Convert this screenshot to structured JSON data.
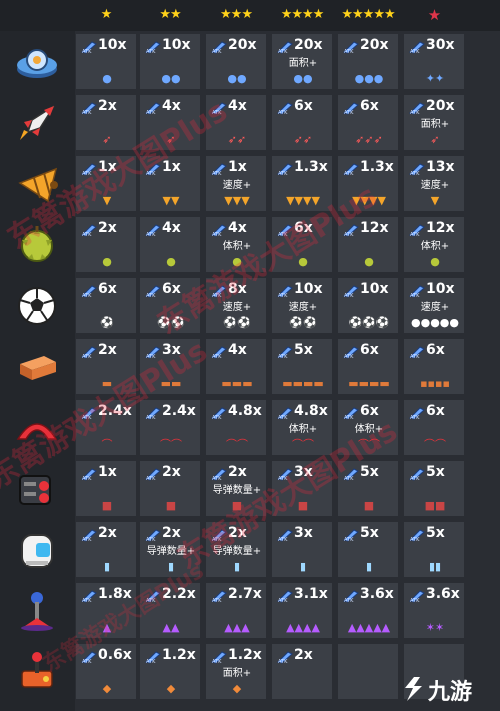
{
  "header": {
    "tiers": [
      "★",
      "★★",
      "★★★",
      "★★★★",
      "★★★★★",
      "★"
    ]
  },
  "colors": {
    "background": "#2a2d33",
    "cell": "#3b3f46",
    "star": "#ffd21a",
    "red_star": "#e0354a",
    "watermark": "#eb283c"
  },
  "rows": [
    {
      "name": "drone",
      "icon": "drone-icon",
      "cells": [
        {
          "mult": "10x",
          "bonus": "",
          "mini": "●"
        },
        {
          "mult": "10x",
          "bonus": "",
          "mini": "●●"
        },
        {
          "mult": "20x",
          "bonus": "",
          "mini": "●●"
        },
        {
          "mult": "20x",
          "bonus": "面积+",
          "mini": "●●"
        },
        {
          "mult": "20x",
          "bonus": "",
          "mini": "●●●"
        },
        {
          "mult": "30x",
          "bonus": "",
          "mini": "✦✦"
        }
      ]
    },
    {
      "name": "rocket",
      "icon": "rocket-icon",
      "cells": [
        {
          "mult": "2x",
          "bonus": "",
          "mini": "➶"
        },
        {
          "mult": "4x",
          "bonus": "",
          "mini": "➶"
        },
        {
          "mult": "4x",
          "bonus": "",
          "mini": "➶➶"
        },
        {
          "mult": "6x",
          "bonus": "",
          "mini": "➶➶"
        },
        {
          "mult": "6x",
          "bonus": "",
          "mini": "➶➶➶"
        },
        {
          "mult": "20x",
          "bonus": "面积+",
          "mini": "➶"
        }
      ]
    },
    {
      "name": "drill",
      "icon": "drill-icon",
      "cells": [
        {
          "mult": "1x",
          "bonus": "",
          "mini": "▼"
        },
        {
          "mult": "1x",
          "bonus": "",
          "mini": "▼▼"
        },
        {
          "mult": "1x",
          "bonus": "速度+",
          "mini": "▼▼▼"
        },
        {
          "mult": "1.3x",
          "bonus": "",
          "mini": "▼▼▼▼"
        },
        {
          "mult": "1.3x",
          "bonus": "",
          "mini": "▼▼▼▼"
        },
        {
          "mult": "13x",
          "bonus": "速度+",
          "mini": "▼"
        }
      ]
    },
    {
      "name": "durian",
      "icon": "durian-icon",
      "cells": [
        {
          "mult": "2x",
          "bonus": "",
          "mini": "●"
        },
        {
          "mult": "4x",
          "bonus": "",
          "mini": "●"
        },
        {
          "mult": "4x",
          "bonus": "体积+",
          "mini": "●"
        },
        {
          "mult": "6x",
          "bonus": "",
          "mini": "●"
        },
        {
          "mult": "12x",
          "bonus": "",
          "mini": "●"
        },
        {
          "mult": "12x",
          "bonus": "体积+",
          "mini": "●"
        }
      ]
    },
    {
      "name": "soccer-ball",
      "icon": "soccer-ball-icon",
      "cells": [
        {
          "mult": "6x",
          "bonus": "",
          "mini": "⚽"
        },
        {
          "mult": "6x",
          "bonus": "",
          "mini": "⚽⚽"
        },
        {
          "mult": "8x",
          "bonus": "速度+",
          "mini": "⚽⚽"
        },
        {
          "mult": "10x",
          "bonus": "速度+",
          "mini": "⚽⚽"
        },
        {
          "mult": "10x",
          "bonus": "",
          "mini": "⚽⚽⚽"
        },
        {
          "mult": "10x",
          "bonus": "速度+",
          "mini": "●●●●●"
        }
      ]
    },
    {
      "name": "brick",
      "icon": "brick-icon",
      "cells": [
        {
          "mult": "2x",
          "bonus": "",
          "mini": "▬"
        },
        {
          "mult": "3x",
          "bonus": "",
          "mini": "▬▬"
        },
        {
          "mult": "4x",
          "bonus": "",
          "mini": "▬▬▬"
        },
        {
          "mult": "5x",
          "bonus": "",
          "mini": "▬▬▬▬"
        },
        {
          "mult": "6x",
          "bonus": "",
          "mini": "▬▬▬▬"
        },
        {
          "mult": "6x",
          "bonus": "",
          "mini": "▪▪▪▪"
        }
      ]
    },
    {
      "name": "boomerang",
      "icon": "boomerang-icon",
      "cells": [
        {
          "mult": "2.4x",
          "bonus": "",
          "mini": "⌒"
        },
        {
          "mult": "2.4x",
          "bonus": "",
          "mini": "⌒⌒"
        },
        {
          "mult": "4.8x",
          "bonus": "",
          "mini": "⌒⌒"
        },
        {
          "mult": "4.8x",
          "bonus": "体积+",
          "mini": "⌒⌒"
        },
        {
          "mult": "6x",
          "bonus": "体积+",
          "mini": "⌒⌒"
        },
        {
          "mult": "6x",
          "bonus": "",
          "mini": "⌒⌒"
        }
      ]
    },
    {
      "name": "missile-launcher",
      "icon": "missile-launcher-icon",
      "cells": [
        {
          "mult": "1x",
          "bonus": "",
          "mini": "■"
        },
        {
          "mult": "2x",
          "bonus": "",
          "mini": "■"
        },
        {
          "mult": "2x",
          "bonus": "导弹数量+",
          "mini": "■"
        },
        {
          "mult": "3x",
          "bonus": "",
          "mini": "■"
        },
        {
          "mult": "5x",
          "bonus": "",
          "mini": "■"
        },
        {
          "mult": "5x",
          "bonus": "",
          "mini": "■■"
        }
      ]
    },
    {
      "name": "laser-device",
      "icon": "laser-device-icon",
      "cells": [
        {
          "mult": "2x",
          "bonus": "",
          "mini": "▮"
        },
        {
          "mult": "2x",
          "bonus": "导弹数量+",
          "mini": "▮"
        },
        {
          "mult": "2x",
          "bonus": "导弹数量+",
          "mini": "▮"
        },
        {
          "mult": "3x",
          "bonus": "",
          "mini": "▮"
        },
        {
          "mult": "5x",
          "bonus": "",
          "mini": "▮"
        },
        {
          "mult": "5x",
          "bonus": "",
          "mini": "▮▮"
        }
      ]
    },
    {
      "name": "tesla-coil",
      "icon": "tesla-coil-icon",
      "cells": [
        {
          "mult": "1.8x",
          "bonus": "",
          "mini": "▲"
        },
        {
          "mult": "2.2x",
          "bonus": "",
          "mini": "▲▲"
        },
        {
          "mult": "2.7x",
          "bonus": "",
          "mini": "▲▲▲"
        },
        {
          "mult": "3.1x",
          "bonus": "",
          "mini": "▲▲▲▲"
        },
        {
          "mult": "3.6x",
          "bonus": "",
          "mini": "▲▲▲▲▲"
        },
        {
          "mult": "3.6x",
          "bonus": "",
          "mini": "✶✶"
        }
      ]
    },
    {
      "name": "joystick",
      "icon": "joystick-icon",
      "cells": [
        {
          "mult": "0.6x",
          "bonus": "",
          "mini": "◆"
        },
        {
          "mult": "1.2x",
          "bonus": "",
          "mini": "◆"
        },
        {
          "mult": "1.2x",
          "bonus": "面积+",
          "mini": "◆"
        },
        {
          "mult": "2x",
          "bonus": "",
          "mini": ""
        },
        {
          "mult": "",
          "bonus": "",
          "mini": ""
        },
        {
          "mult": "",
          "bonus": "",
          "mini": ""
        }
      ]
    }
  ],
  "watermark": {
    "text": "东篱游戏大图Plus"
  },
  "logo": {
    "text": "九游"
  }
}
